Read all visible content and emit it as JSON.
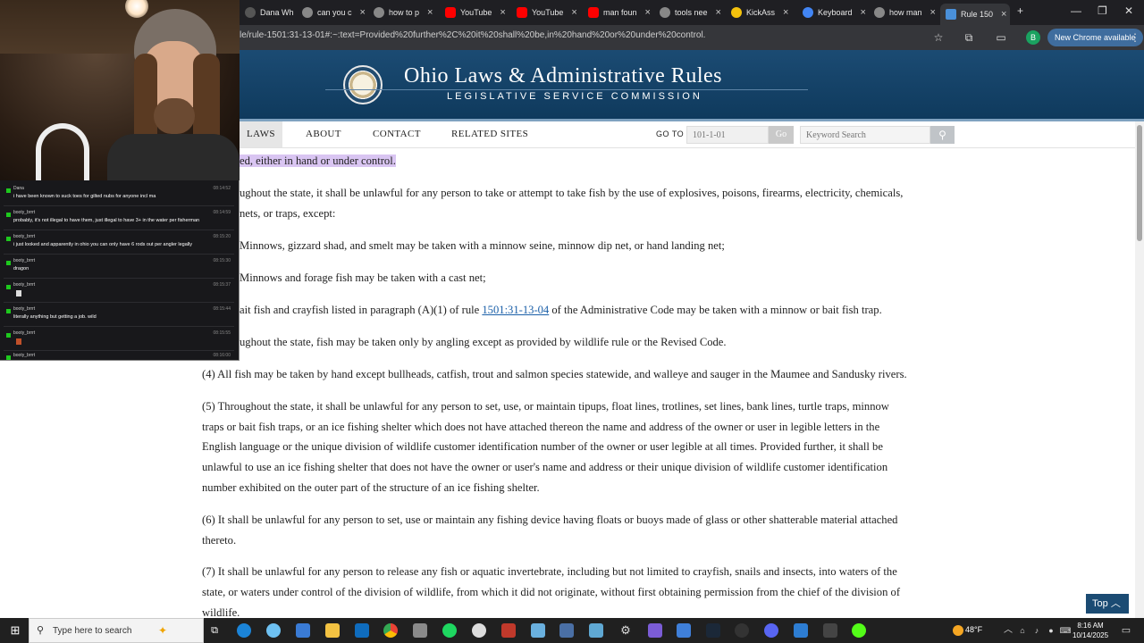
{
  "browser": {
    "tabs": [
      {
        "label": "Dana Wh",
        "color": "#555"
      },
      {
        "label": "can you c",
        "color": "#888"
      },
      {
        "label": "how to p",
        "color": "#888"
      },
      {
        "label": "YouTube",
        "color": "#ff0000"
      },
      {
        "label": "YouTube",
        "color": "#ff0000"
      },
      {
        "label": "man foun",
        "color": "#ff0000"
      },
      {
        "label": "tools nee",
        "color": "#888"
      },
      {
        "label": "KickAss",
        "color": "#f4c20d"
      },
      {
        "label": "Keyboard",
        "color": "#4285f4"
      },
      {
        "label": "how man",
        "color": "#888"
      },
      {
        "label": "Rule 150",
        "color": "#4a90d9"
      }
    ],
    "url": "le/rule-1501:31-13-01#:~:text=Provided%20further%2C%20it%20shall%20be,in%20hand%20or%20under%20control.",
    "new_chrome_label": "New Chrome available",
    "profile_initial": "B"
  },
  "site": {
    "title": "Ohio Laws & Administrative Rules",
    "subtitle": "LEGISLATIVE SERVICE COMMISSION"
  },
  "nav": {
    "laws": "LAWS",
    "about": "ABOUT",
    "contact": "CONTACT",
    "related": "RELATED SITES",
    "goto_label": "GO TO",
    "goto_placeholder": "101-1-01",
    "go_button": "Go",
    "keyword_placeholder": "Keyword Search"
  },
  "content": {
    "highlight_line": "ed, either in hand or under control.",
    "p_b_line1": "ughout the state, it shall be unlawful for any person to take or attempt to take fish by the use of explosives, poisons, firearms, electricity, chemicals,",
    "p_b_line2": "nets, or traps, except:",
    "p_b1": "Minnows, gizzard shad, and smelt may be taken with a minnow seine, minnow dip net, or hand landing net;",
    "p_b2": "Minnows and forage fish may be taken with a cast net;",
    "p_b3_pre": "ait fish and crayfish listed in paragraph (A)(1) of rule ",
    "p_b3_link": "1501:31-13-04",
    "p_b3_post": " of the Administrative Code may be taken with a minnow or bait fish trap.",
    "p_c": "ughout the state, fish may be taken only by angling except as provided by wildlife rule or the Revised Code.",
    "p4": "(4) All fish may be taken by hand except bullheads, catfish, trout and salmon species statewide, and walleye and sauger in the Maumee and Sandusky rivers.",
    "p5_l1": "(5) Throughout the state, it shall be unlawful for any person to set, use, or maintain tipups, float lines, trotlines, set lines, bank lines, turtle traps, minnow",
    "p5_l2": "traps or bait fish traps, or an ice fishing shelter which does not have attached thereon the name and address of the owner or user in legible letters in the",
    "p5_l3": "English language or the unique division of wildlife customer identification number of the owner or user legible at all times. Provided further, it shall be",
    "p5_l4": "unlawful to use an ice fishing shelter that does not have the owner or user's name and address or their unique division of wildlife customer identification",
    "p5_l5": "number exhibited on the outer part of the structure of an ice fishing shelter.",
    "p6_l1": "(6) It shall be unlawful for any person to set, use or maintain any fishing device having floats or buoys made of glass or other shatterable material attached",
    "p6_l2": "thereto.",
    "p7_l1": "(7) It shall be unlawful for any person to release any fish or aquatic invertebrate, including but not limited to crayfish, snails and insects, into waters of the",
    "p7_l2": "state, or waters under control of the division of wildlife, from which it did not originate, without first obtaining permission from the chief of the division of",
    "p7_l3": "wildlife."
  },
  "top_button": "Top",
  "chat": [
    {
      "user": "Dana",
      "time": "08:14:52",
      "text": "i have been known to suck toes for gilted nubs for anyone incl ma"
    },
    {
      "user": "booty_brrrt",
      "time": "08:14:59",
      "text": "probably, it's not illegal to have them, just illegal to have 3+ in the water per fisherman"
    },
    {
      "user": "booty_brrrt",
      "time": "08:15:20",
      "text": "i just looked and apparently in ohio you can only have 6 rods out per angler legally"
    },
    {
      "user": "booty_brrrt",
      "time": "08:15:30",
      "text": "dragon"
    },
    {
      "user": "booty_brrrt",
      "time": "08:15:37",
      "text": ""
    },
    {
      "user": "booty_brrrt",
      "time": "08:15:44",
      "text": "literally anything but getting a job. wild"
    },
    {
      "user": "booty_brrrt",
      "time": "08:15:55",
      "text": ""
    },
    {
      "user": "booty_brrrt",
      "time": "08:16:00",
      "text": ""
    }
  ],
  "taskbar": {
    "search_placeholder": "Type here to search",
    "weather": "48°F",
    "time": "8:16 AM",
    "date": "10/14/2025"
  }
}
